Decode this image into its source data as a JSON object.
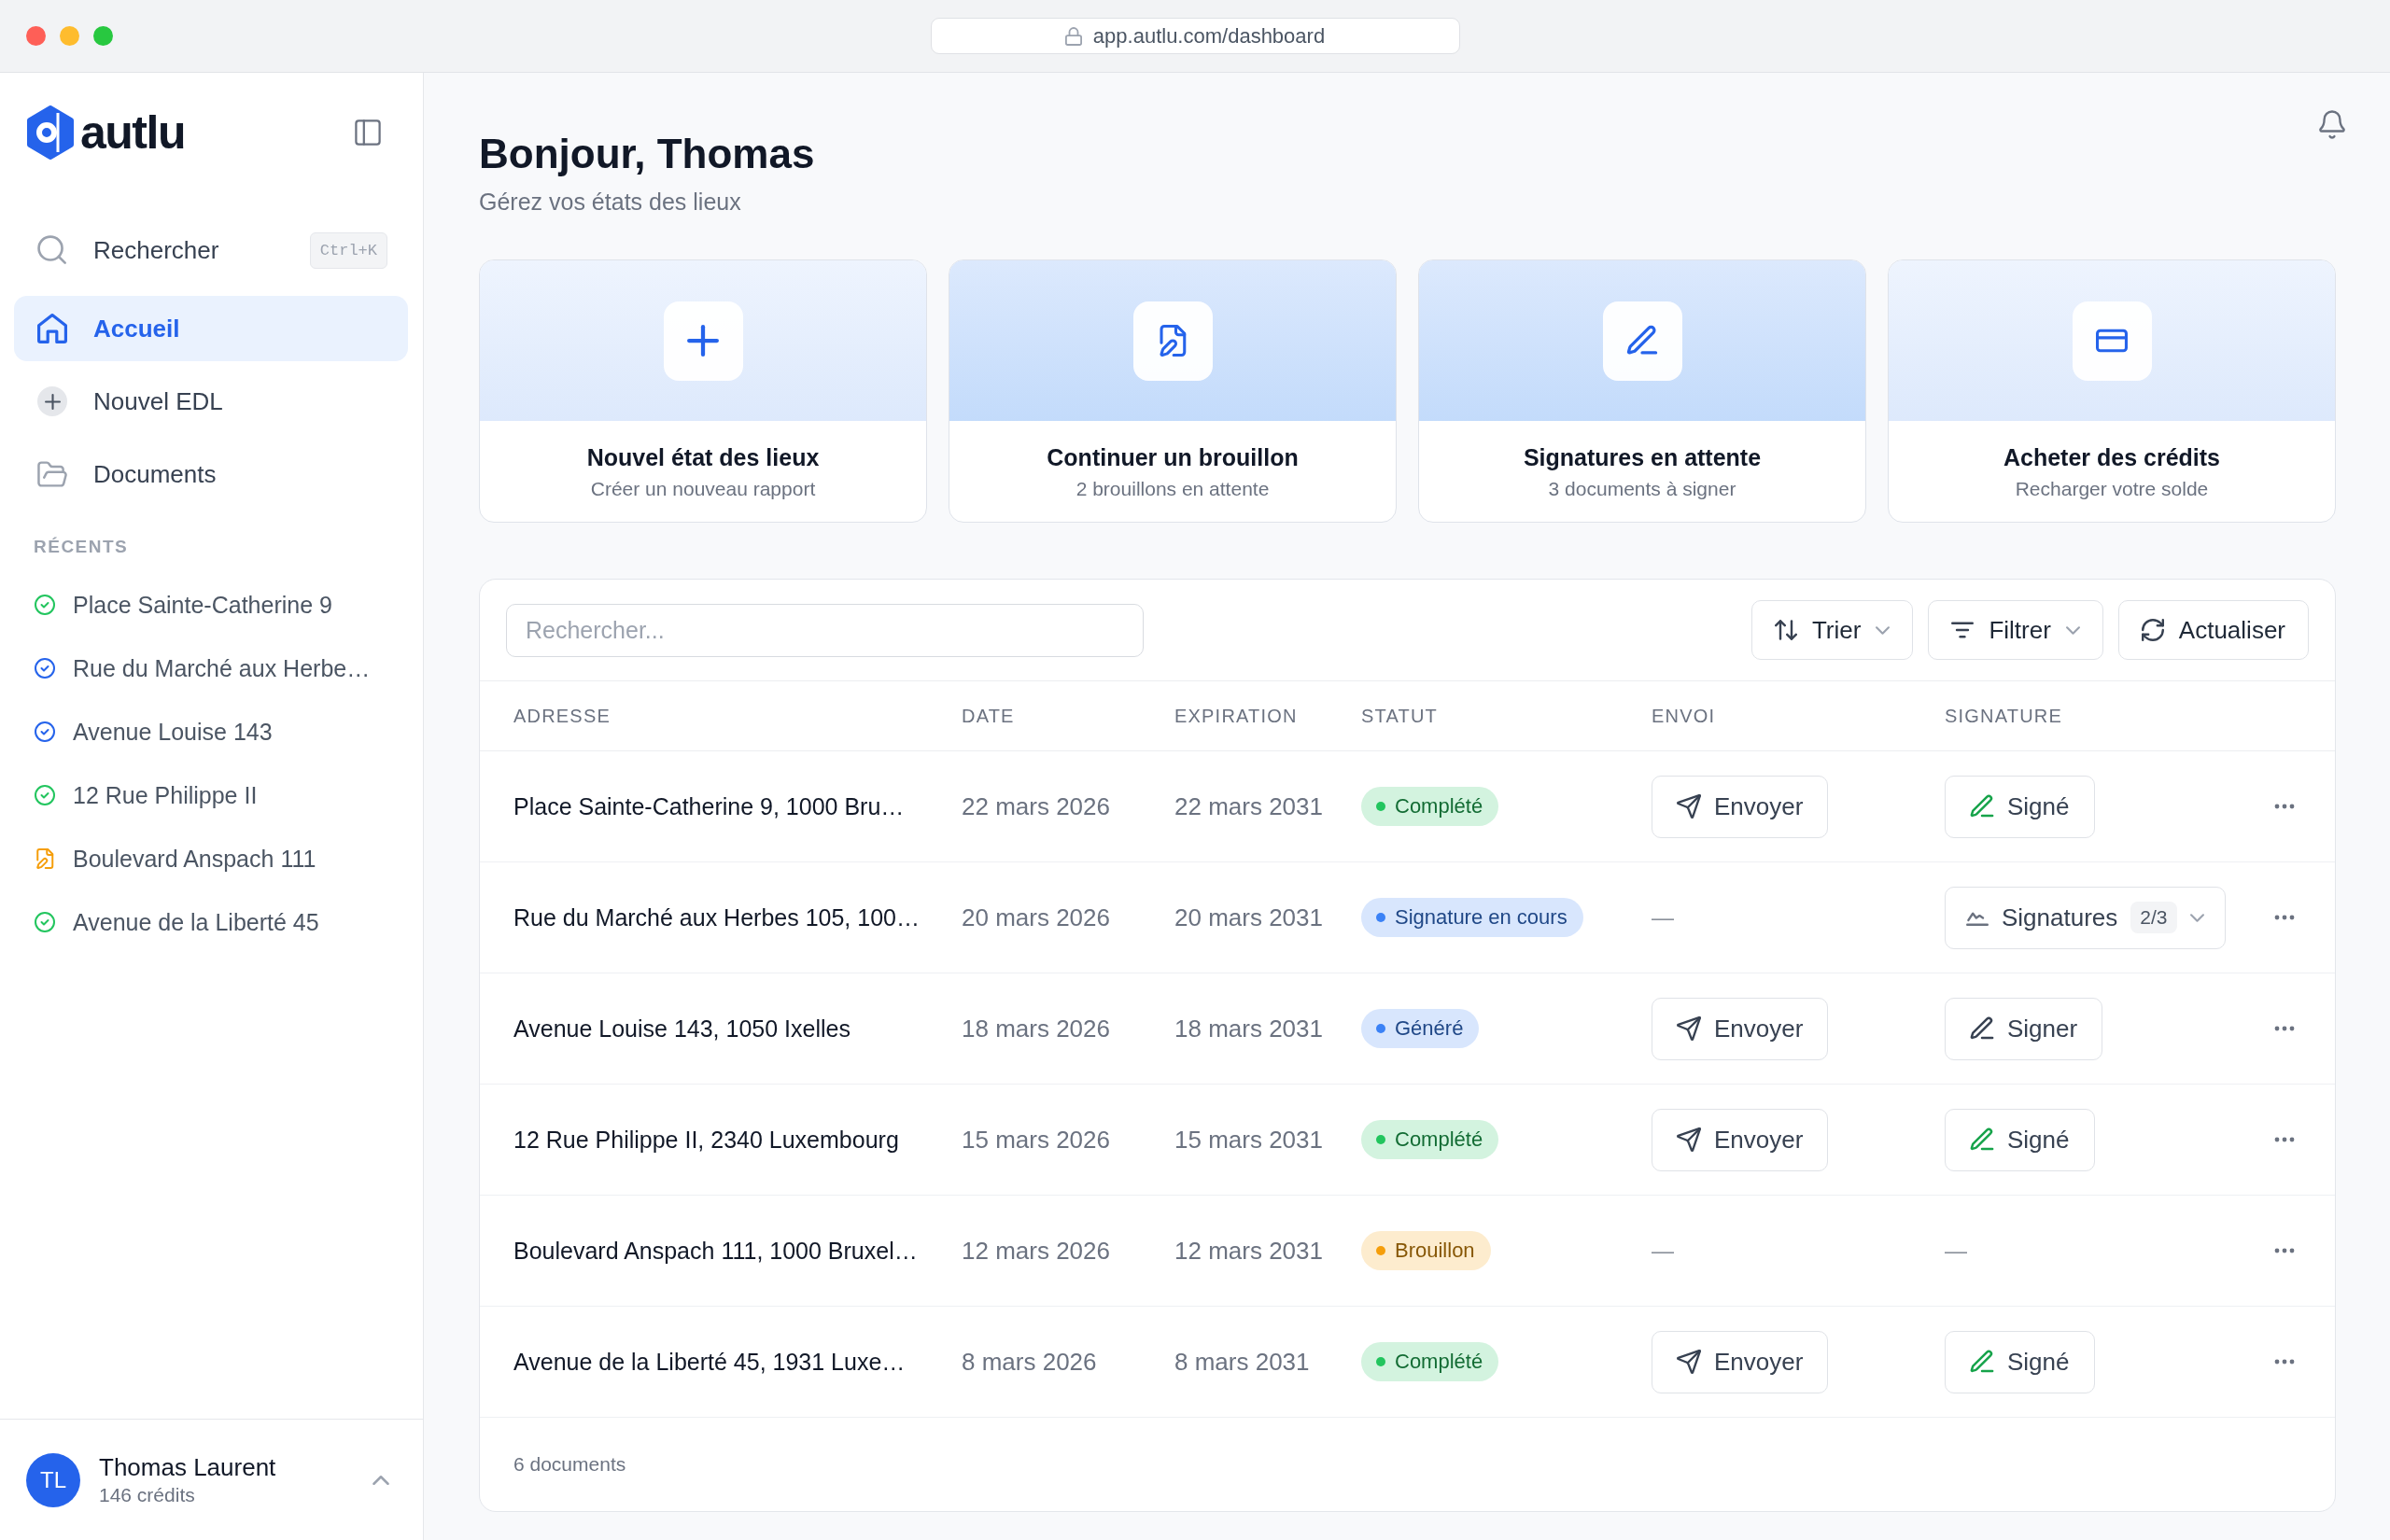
{
  "browser": {
    "url": "app.autlu.com/dashboard"
  },
  "sidebar": {
    "brand": "autlu",
    "nav": [
      {
        "label": "Rechercher",
        "shortcut": "Ctrl+K",
        "selected": false
      },
      {
        "label": "Accueil",
        "selected": true
      },
      {
        "label": "Nouvel EDL",
        "selected": false
      },
      {
        "label": "Documents",
        "selected": false
      }
    ],
    "recents_title": "RÉCENTS",
    "recents": [
      {
        "label": "Place Sainte-Catherine 9",
        "kind": "done",
        "color": "#22c55e"
      },
      {
        "label": "Rue du Marché aux Herbe…",
        "kind": "done",
        "color": "#2563eb"
      },
      {
        "label": "Avenue Louise 143",
        "kind": "done",
        "color": "#2563eb"
      },
      {
        "label": "12 Rue Philippe II",
        "kind": "done",
        "color": "#22c55e"
      },
      {
        "label": "Boulevard Anspach 111",
        "kind": "draft",
        "color": "#f59e0b"
      },
      {
        "label": "Avenue de la Liberté 45",
        "kind": "done",
        "color": "#22c55e"
      }
    ],
    "user": {
      "initials": "TL",
      "name": "Thomas Laurent",
      "credits": "146 crédits"
    }
  },
  "header": {
    "title": "Bonjour, Thomas",
    "subtitle": "Gérez vos états des lieux"
  },
  "cards": [
    {
      "title": "Nouvel état des lieux",
      "subtitle": "Créer un nouveau rapport",
      "highlighted": false
    },
    {
      "title": "Continuer un brouillon",
      "subtitle": "2 brouillons en attente",
      "highlighted": true
    },
    {
      "title": "Signatures en attente",
      "subtitle": "3 documents à signer",
      "highlighted": true
    },
    {
      "title": "Acheter des crédits",
      "subtitle": "Recharger votre solde",
      "highlighted": false
    }
  ],
  "table": {
    "search": {
      "placeholder": "Rechercher..."
    },
    "toolbar": [
      {
        "label": "Trier",
        "kind": "menu"
      },
      {
        "label": "Filtrer",
        "kind": "menu"
      },
      {
        "label": "Actualiser",
        "kind": "action"
      }
    ],
    "columns": [
      "ADRESSE",
      "DATE",
      "EXPIRATION",
      "STATUT",
      "ENVOI",
      "SIGNATURE"
    ],
    "rows": [
      {
        "address": "Place Sainte-Catherine 9, 1000 Bru…",
        "date": "22 mars 2026",
        "expiration": "22 mars 2031",
        "status": {
          "label": "Complété",
          "color": "#22c55e"
        },
        "send": {
          "kind": "button",
          "label": "Envoyer"
        },
        "signature": {
          "kind": "signed",
          "label": "Signé"
        }
      },
      {
        "address": "Rue du Marché aux Herbes 105, 100…",
        "date": "20 mars 2026",
        "expiration": "20 mars 2031",
        "status": {
          "label": "Signature en cours",
          "color": "#3b82f6"
        },
        "send": {
          "kind": "none",
          "label": "—"
        },
        "signature": {
          "kind": "progress",
          "label": "Signatures",
          "count": "2/3"
        }
      },
      {
        "address": "Avenue Louise 143, 1050 Ixelles",
        "date": "18 mars 2026",
        "expiration": "18 mars 2031",
        "status": {
          "label": "Généré",
          "color": "#3b82f6"
        },
        "send": {
          "kind": "button",
          "label": "Envoyer"
        },
        "signature": {
          "kind": "sign",
          "label": "Signer"
        }
      },
      {
        "address": "12 Rue Philippe II, 2340 Luxembourg",
        "date": "15 mars 2026",
        "expiration": "15 mars 2031",
        "status": {
          "label": "Complété",
          "color": "#22c55e"
        },
        "send": {
          "kind": "button",
          "label": "Envoyer"
        },
        "signature": {
          "kind": "signed",
          "label": "Signé"
        }
      },
      {
        "address": "Boulevard Anspach 111, 1000 Bruxel…",
        "date": "12 mars 2026",
        "expiration": "12 mars 2031",
        "status": {
          "label": "Brouillon",
          "color": "#f59e0b"
        },
        "send": {
          "kind": "none",
          "label": "—"
        },
        "signature": {
          "kind": "none",
          "label": "—"
        }
      },
      {
        "address": "Avenue de la Liberté 45, 1931 Luxe…",
        "date": "8 mars 2026",
        "expiration": "8 mars 2031",
        "status": {
          "label": "Complété",
          "color": "#22c55e"
        },
        "send": {
          "kind": "button",
          "label": "Envoyer"
        },
        "signature": {
          "kind": "signed",
          "label": "Signé"
        }
      }
    ],
    "footer": "6 documents"
  }
}
